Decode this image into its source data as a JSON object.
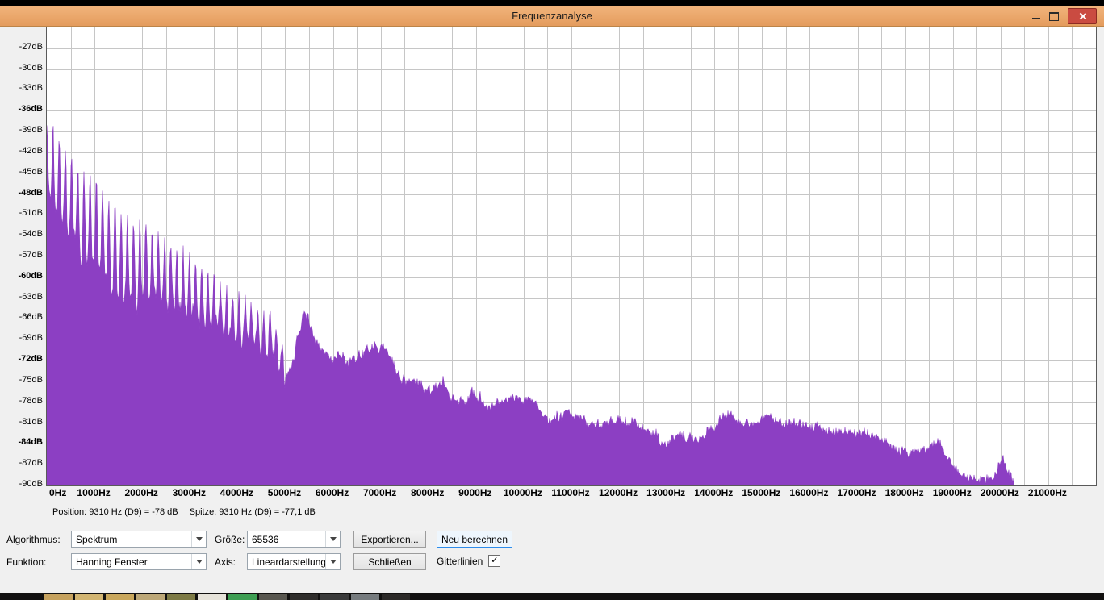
{
  "window": {
    "title": "Frequenzanalyse"
  },
  "icons": {
    "check": "✓"
  },
  "status": {
    "position": "Position: 9310 Hz (D9) = -78 dB",
    "peak": "Spitze: 9310 Hz (D9) = -77,1 dB"
  },
  "form": {
    "algorithm_label": "Algorithmus:",
    "algorithm_value": "Spektrum",
    "size_label": "Größe:",
    "size_value": "65536",
    "export_button": "Exportieren...",
    "recalc_button": "Neu berechnen",
    "function_label": "Funktion:",
    "function_value": "Hanning Fenster",
    "axis_label": "Axis:",
    "axis_value": "Lineardarstellung",
    "close_button": "Schließen",
    "gridlines_label": "Gitterlinien",
    "gridlines_checked": true
  },
  "taskbar": {
    "icon_colors": [
      "#c6a25e",
      "#d2b572",
      "#c9a75c",
      "#bda878",
      "#7d7a45",
      "#e6e3da",
      "#3e9e53",
      "#58564f",
      "#2f2d2b",
      "#3a3a3a",
      "#767b7e",
      "#2c2a28"
    ]
  },
  "chart_data": {
    "type": "area",
    "title": "Frequenzanalyse",
    "x_unit": "Hz",
    "y_unit": "dB",
    "x_range_hz": [
      0,
      22000
    ],
    "y_range_db": [
      -90,
      -24
    ],
    "x_grid_step_hz": 500,
    "y_grid_step_db": 3,
    "grid": true,
    "legend": "none",
    "bar_color": "#8c3fc3",
    "grid_color": "#c6c6c6",
    "x_ticks_hz": [
      0,
      1000,
      2000,
      3000,
      4000,
      5000,
      6000,
      7000,
      8000,
      9000,
      10000,
      11000,
      12000,
      13000,
      14000,
      15000,
      16000,
      17000,
      18000,
      19000,
      20000,
      21000
    ],
    "y_ticks_db": [
      -27,
      -30,
      -33,
      -36,
      -39,
      -42,
      -45,
      -48,
      -51,
      -54,
      -57,
      -60,
      -63,
      -66,
      -69,
      -72,
      -75,
      -78,
      -81,
      -84,
      -87,
      -90
    ],
    "y_bold_ticks_db": [
      -36,
      -48,
      -60,
      -72,
      -84
    ],
    "harmonic_spacing_hz": 130,
    "cursor_position_db": {
      "freq_hz": 9310,
      "note": "D9",
      "value_db": -78
    },
    "cursor_peak_db": {
      "freq_hz": 9310,
      "note": "D9",
      "value_db": -77.1
    },
    "envelope_db": [
      [
        0,
        -37.5
      ],
      [
        60,
        -37
      ],
      [
        150,
        -39
      ],
      [
        300,
        -41
      ],
      [
        500,
        -42.5
      ],
      [
        700,
        -44
      ],
      [
        900,
        -45
      ],
      [
        1000,
        -44.5
      ],
      [
        1200,
        -47
      ],
      [
        1400,
        -49
      ],
      [
        1600,
        -50
      ],
      [
        1700,
        -51
      ],
      [
        1900,
        -52.5
      ],
      [
        2100,
        -52
      ],
      [
        2300,
        -54
      ],
      [
        2500,
        -55
      ],
      [
        2700,
        -55.5
      ],
      [
        2900,
        -56.5
      ],
      [
        3100,
        -57
      ],
      [
        3300,
        -59
      ],
      [
        3500,
        -60
      ],
      [
        3700,
        -61.5
      ],
      [
        3900,
        -62
      ],
      [
        4100,
        -63
      ],
      [
        4300,
        -64
      ],
      [
        4500,
        -64.5
      ],
      [
        4700,
        -65.5
      ],
      [
        4900,
        -68
      ],
      [
        5050,
        -71
      ],
      [
        5200,
        -66
      ],
      [
        5350,
        -62
      ],
      [
        5450,
        -61.5
      ],
      [
        5600,
        -64
      ],
      [
        5800,
        -66.5
      ],
      [
        6000,
        -68.5
      ],
      [
        6200,
        -67.5
      ],
      [
        6400,
        -68
      ],
      [
        6600,
        -69
      ],
      [
        6800,
        -67
      ],
      [
        7000,
        -66.5
      ],
      [
        7100,
        -67
      ],
      [
        7300,
        -70
      ],
      [
        7500,
        -72
      ],
      [
        7700,
        -71.5
      ],
      [
        7900,
        -73
      ],
      [
        8100,
        -74
      ],
      [
        8300,
        -73.5
      ],
      [
        8500,
        -75
      ],
      [
        8700,
        -75.5
      ],
      [
        8900,
        -74.5
      ],
      [
        9100,
        -75
      ],
      [
        9310,
        -77.1
      ],
      [
        9500,
        -76
      ],
      [
        9700,
        -74.5
      ],
      [
        9900,
        -76
      ],
      [
        10100,
        -75
      ],
      [
        10300,
        -76.5
      ],
      [
        10600,
        -78
      ],
      [
        10900,
        -77.5
      ],
      [
        11200,
        -78
      ],
      [
        11500,
        -79.5
      ],
      [
        11800,
        -79
      ],
      [
        12100,
        -78.5
      ],
      [
        12400,
        -79.5
      ],
      [
        12700,
        -80.5
      ],
      [
        13000,
        -81.5
      ],
      [
        13300,
        -80.5
      ],
      [
        13600,
        -81
      ],
      [
        13900,
        -79
      ],
      [
        14200,
        -77.5
      ],
      [
        14500,
        -78
      ],
      [
        14800,
        -79
      ],
      [
        15100,
        -78
      ],
      [
        15400,
        -79
      ],
      [
        15700,
        -78.5
      ],
      [
        16000,
        -79
      ],
      [
        16300,
        -79.5
      ],
      [
        16600,
        -80
      ],
      [
        16900,
        -80.5
      ],
      [
        17200,
        -80.5
      ],
      [
        17500,
        -81.5
      ],
      [
        17800,
        -82.5
      ],
      [
        18100,
        -83.5
      ],
      [
        18400,
        -83
      ],
      [
        18700,
        -82
      ],
      [
        18900,
        -84
      ],
      [
        19100,
        -86
      ],
      [
        19300,
        -87
      ],
      [
        19600,
        -87.5
      ],
      [
        19900,
        -87
      ],
      [
        20050,
        -84.5
      ],
      [
        20200,
        -87.5
      ],
      [
        20400,
        -90
      ],
      [
        20600,
        -96
      ],
      [
        22000,
        -96
      ]
    ],
    "valley_depth_db": [
      [
        0,
        13
      ],
      [
        400,
        15
      ],
      [
        800,
        16
      ],
      [
        1200,
        16
      ],
      [
        1600,
        15
      ],
      [
        2000,
        13
      ],
      [
        2400,
        12
      ],
      [
        2800,
        11
      ],
      [
        3200,
        10
      ],
      [
        3600,
        8
      ],
      [
        4200,
        7
      ],
      [
        5000,
        7
      ],
      [
        5600,
        7
      ],
      [
        6200,
        6
      ],
      [
        7000,
        5.5
      ],
      [
        8000,
        5
      ],
      [
        9000,
        4.5
      ],
      [
        10000,
        4
      ],
      [
        12000,
        4
      ],
      [
        14000,
        4.5
      ],
      [
        16000,
        4
      ],
      [
        18000,
        3.5
      ],
      [
        19500,
        3
      ],
      [
        20300,
        2
      ],
      [
        22000,
        2
      ]
    ]
  }
}
